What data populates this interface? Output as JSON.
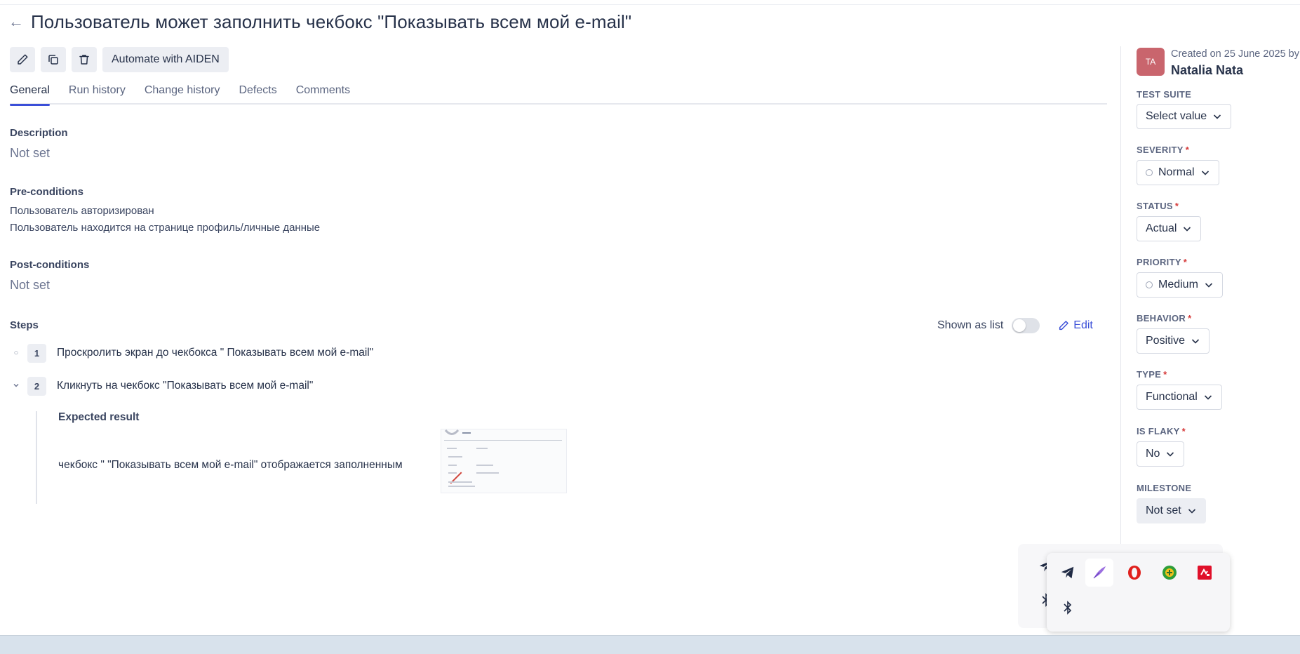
{
  "header": {
    "back_icon": "arrow-left-icon",
    "title": "Пользователь может заполнить чекбокс \"Показывать всем мой e-mail\""
  },
  "toolbar": {
    "edit_icon": "pencil-icon",
    "copy_icon": "copy-icon",
    "delete_icon": "trash-icon",
    "automate_label": "Automate with AIDEN"
  },
  "tabs": [
    {
      "label": "General",
      "active": true
    },
    {
      "label": "Run history",
      "active": false
    },
    {
      "label": "Change history",
      "active": false
    },
    {
      "label": "Defects",
      "active": false
    },
    {
      "label": "Comments",
      "active": false
    }
  ],
  "description": {
    "label": "Description",
    "value": "Not set"
  },
  "preconditions": {
    "label": "Pre-conditions",
    "lines": [
      "Пользователь авторизирован",
      "Пользователь находится на странице профиль/личные данные"
    ]
  },
  "postconditions": {
    "label": "Post-conditions",
    "value": "Not set"
  },
  "steps": {
    "label": "Steps",
    "shown_as_list_label": "Shown as list",
    "shown_as_list": false,
    "edit_label": "Edit",
    "items": [
      {
        "number": "1",
        "text": "Проскролить экран до чекбокса \" Показывать всем мой e-mail\"",
        "expanded": false
      },
      {
        "number": "2",
        "text": "Кликнуть на чекбокс \"Показывать всем мой e-mail\"",
        "expanded": true
      }
    ],
    "expected": {
      "label": "Expected result",
      "text": "чекбокс \" \"Показывать всем мой e-mail\" отображается заполненным"
    }
  },
  "sidebar": {
    "avatar_initials": "TA",
    "avatar_color": "#c9656d",
    "created_text": "Created on 25 June 2025 by",
    "author": "Natalia Nata",
    "fields": {
      "test_suite": {
        "label": "TEST SUITE",
        "value": "Select value",
        "required": false
      },
      "severity": {
        "label": "SEVERITY",
        "value": "Normal",
        "required": true
      },
      "status": {
        "label": "STATUS",
        "value": "Actual",
        "required": true
      },
      "priority": {
        "label": "PRIORITY",
        "value": "Medium",
        "required": true
      },
      "behavior": {
        "label": "BEHAVIOR",
        "value": "Positive",
        "required": true
      },
      "type": {
        "label": "TYPE",
        "value": "Functional",
        "required": true
      },
      "is_flaky": {
        "label": "IS FLAKY",
        "value": "No",
        "required": true
      },
      "milestone": {
        "label": "MILESTONE",
        "value": "Not set",
        "required": false
      }
    },
    "required_mark": "*"
  },
  "tray": {
    "icons": [
      "telegram-icon",
      "feather-pen-icon",
      "opera-icon",
      "green-plus-icon",
      "red-app-icon",
      "bluetooth-icon"
    ]
  },
  "colors": {
    "accent": "#3b4fd8",
    "required": "#d63b3b"
  }
}
